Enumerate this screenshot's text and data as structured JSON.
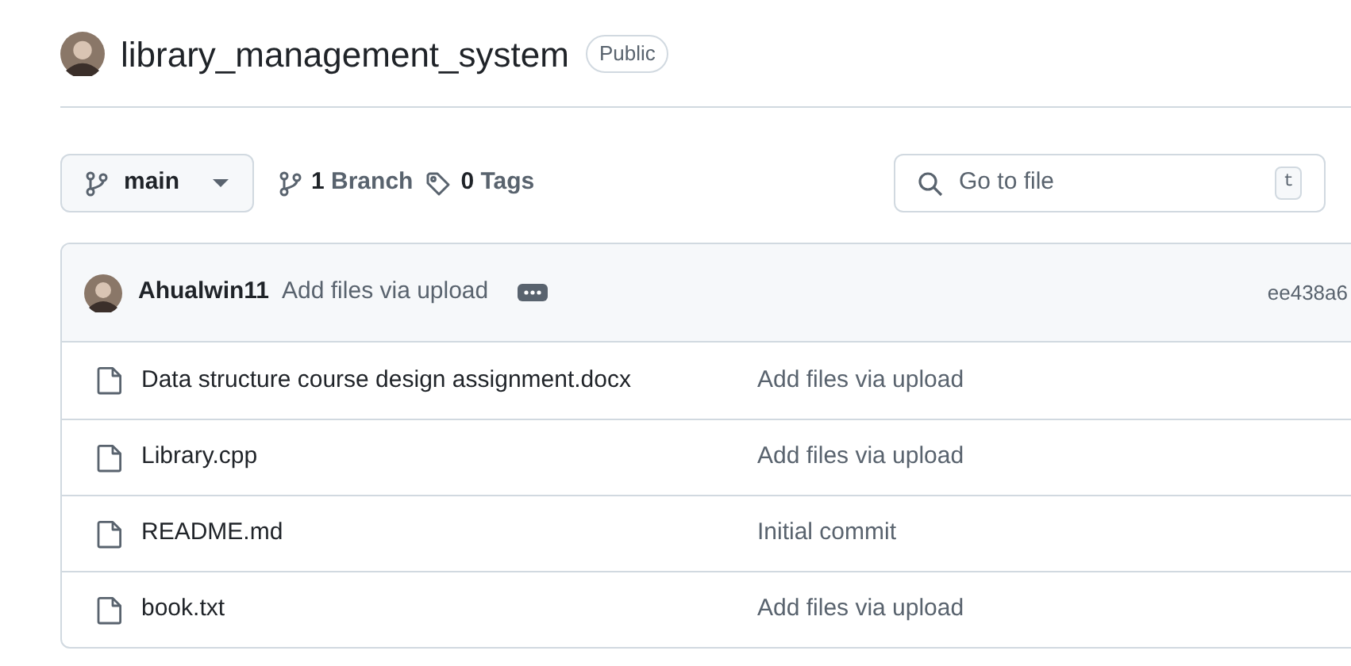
{
  "repo": {
    "name": "library_management_system",
    "visibility": "Public"
  },
  "toolbar": {
    "branch": "main",
    "branches": {
      "count": "1",
      "label": "Branch"
    },
    "tags": {
      "count": "0",
      "label": "Tags"
    },
    "search": {
      "placeholder": "Go to file",
      "shortcut": "t"
    }
  },
  "latest_commit": {
    "author": "Ahualwin11",
    "message": "Add files via upload",
    "hash": "ee438a6"
  },
  "files": [
    {
      "name": "Data structure course design assignment.docx",
      "commit": "Add files via upload"
    },
    {
      "name": "Library.cpp",
      "commit": "Add files via upload"
    },
    {
      "name": "README.md",
      "commit": "Initial commit"
    },
    {
      "name": "book.txt",
      "commit": "Add files via upload"
    }
  ]
}
